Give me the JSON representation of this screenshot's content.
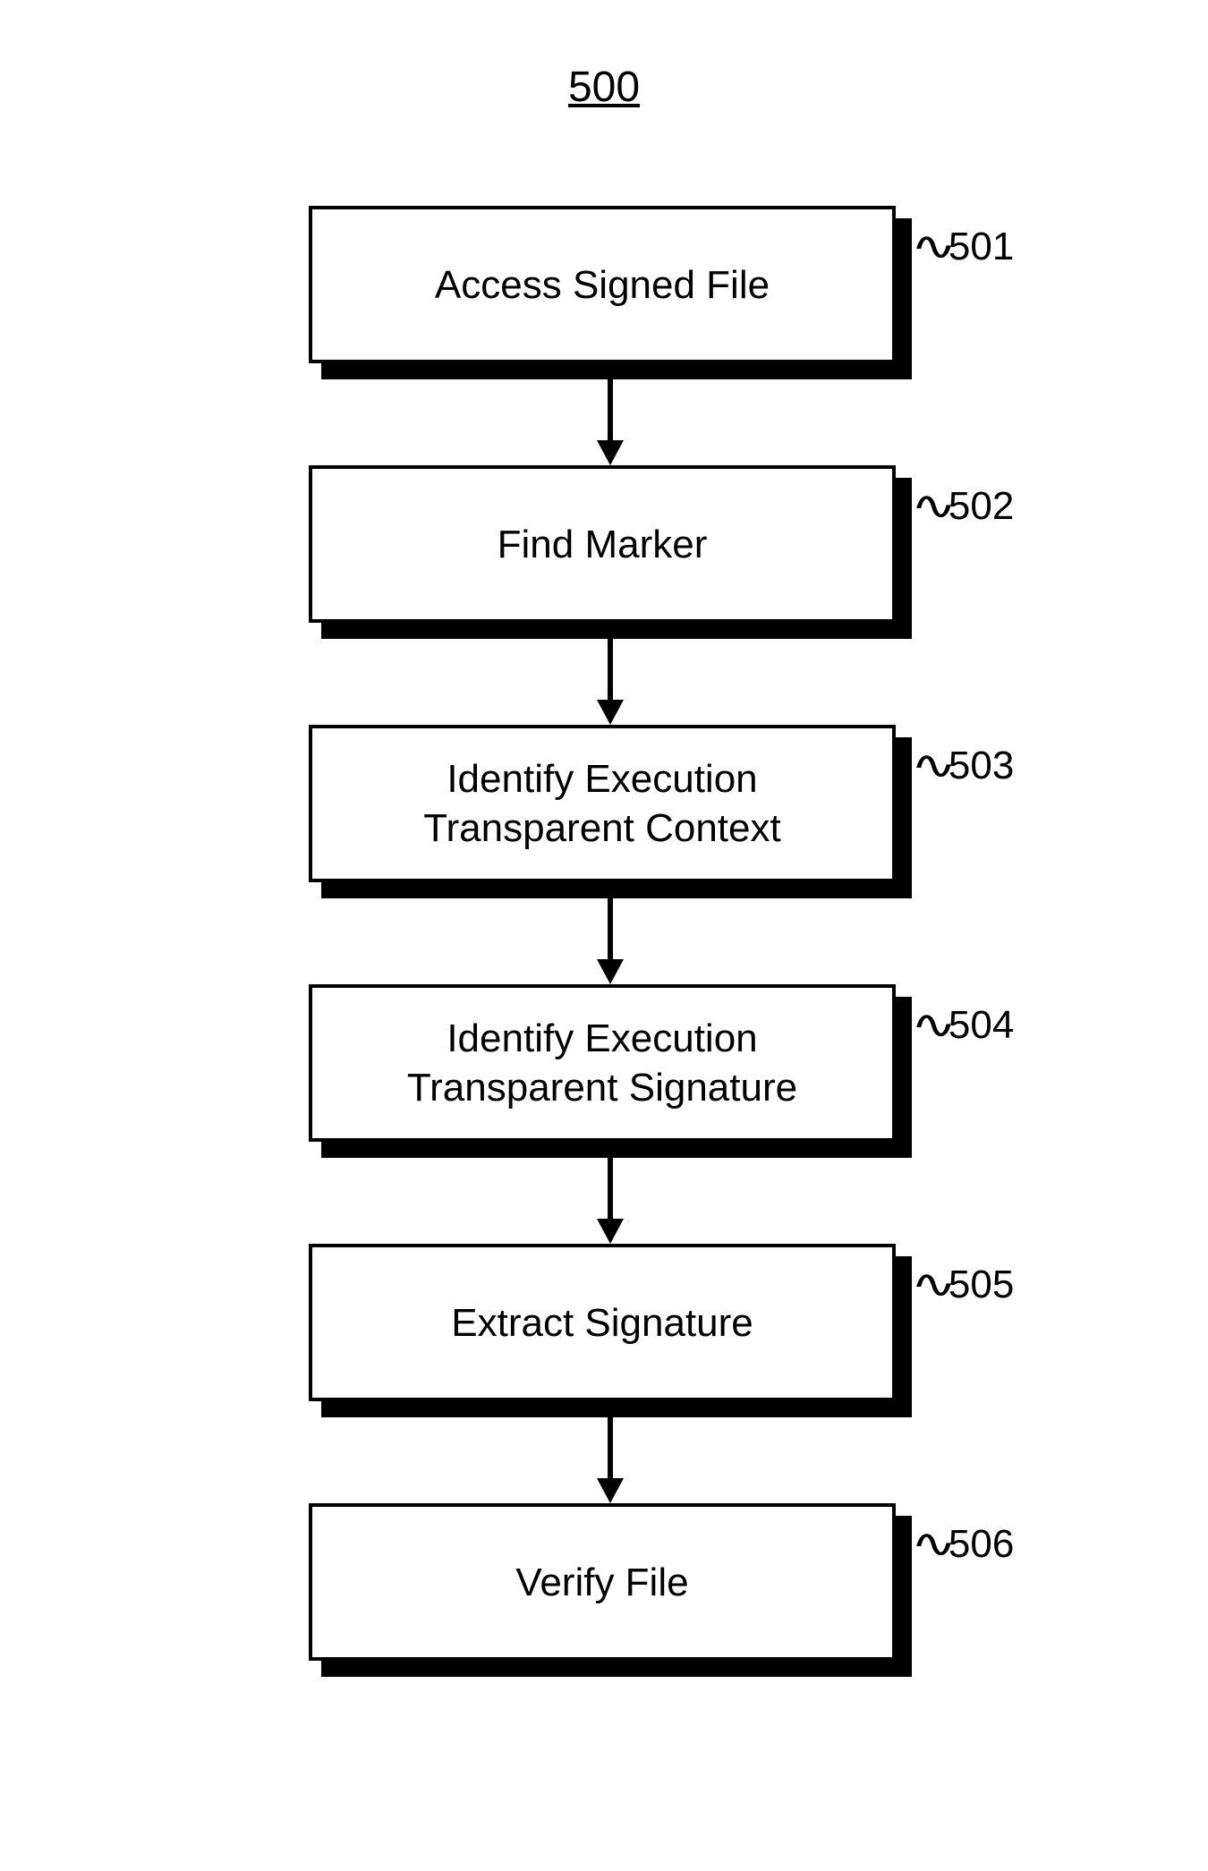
{
  "figure_number": "500",
  "steps": [
    {
      "id": "501",
      "text": "Access Signed File"
    },
    {
      "id": "502",
      "text": "Find Marker"
    },
    {
      "id": "503",
      "text": "Identify Execution\nTransparent Context"
    },
    {
      "id": "504",
      "text": "Identify Execution\nTransparent Signature"
    },
    {
      "id": "505",
      "text": "Extract Signature"
    },
    {
      "id": "506",
      "text": "Verify File"
    }
  ]
}
